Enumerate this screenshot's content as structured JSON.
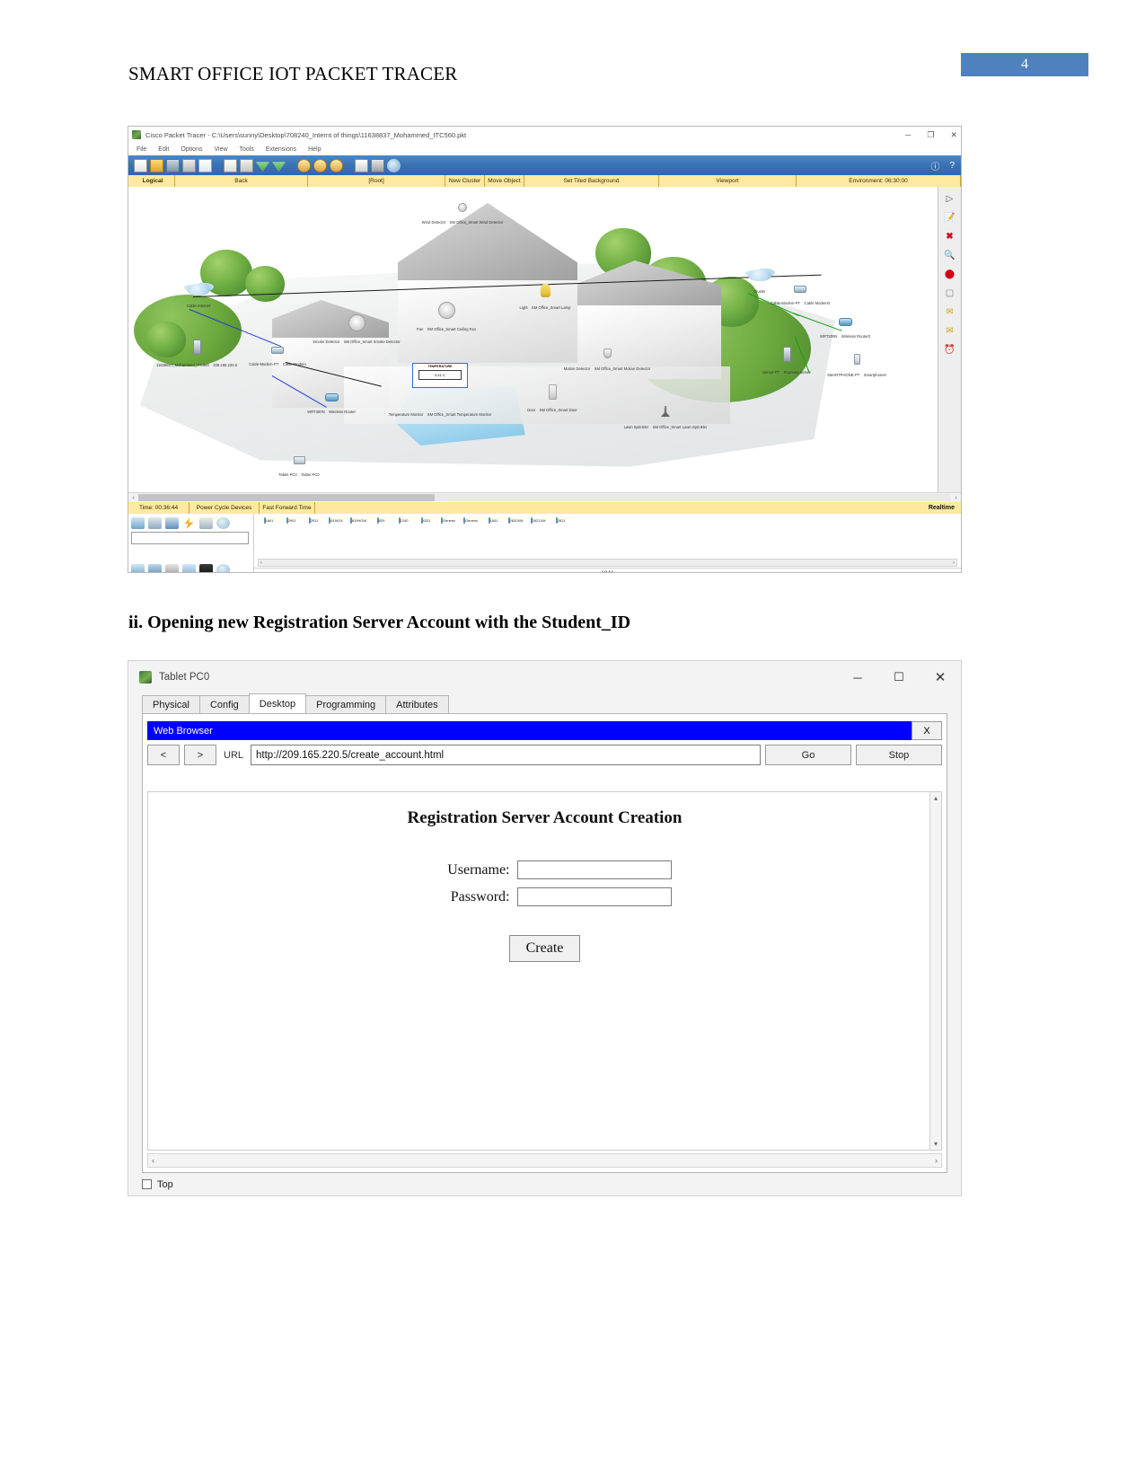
{
  "document": {
    "title": "SMART OFFICE IOT PACKET TRACER",
    "page_number": "4",
    "section_heading": "ii. Opening new Registration Server Account with the Student_ID",
    "accent_color": "#4f81bd"
  },
  "packet_tracer": {
    "window_title": "Cisco Packet Tracer - C:\\Users\\sunny\\Desktop\\708240_Internt of things\\11638837_Mohammed_ITC560.pkt",
    "window_controls": {
      "minimize": "─",
      "maximize": "❐",
      "close": "✕"
    },
    "menu": [
      "File",
      "Edit",
      "Options",
      "View",
      "Tools",
      "Extensions",
      "Help"
    ],
    "toolbar_icons": [
      "new-file-icon",
      "open-file-icon",
      "save-icon",
      "print-icon",
      "activity-wizard-icon",
      "copy-icon",
      "paste-icon",
      "undo-icon",
      "redo-icon",
      "zoom-in-icon",
      "zoom-reset-icon",
      "zoom-out-icon",
      "palette-icon",
      "custom-devices-icon",
      "network-info-icon"
    ],
    "toolbar_right": [
      "info-icon",
      "help-icon"
    ],
    "view_bar": {
      "mode": "Logical",
      "back": "Back",
      "root": "[Root]",
      "new_cluster": "New Cluster",
      "move_object": "Move Object",
      "set_tiled_background": "Set Tiled Background",
      "viewport": "Viewport",
      "environment": "Environment: 06:30:00"
    },
    "topology_nodes": [
      {
        "name": "Cable Internet",
        "label": "Cable Internet",
        "sublabel": ""
      },
      {
        "name": "cluster",
        "label": "Cluster",
        "sublabel": ""
      },
      {
        "name": "wind-detector",
        "label": "Wind Detector",
        "sublabel": "SM Office_Smart Wind Detector"
      },
      {
        "name": "smoke-detector",
        "label": "Smoke Detector",
        "sublabel": "SM Office_Smart Smoke Detector"
      },
      {
        "name": "ceiling-fan",
        "label": "Fan",
        "sublabel": "SM Office_Smart Ceiling Fan"
      },
      {
        "name": "smart-lamp",
        "label": "Light",
        "sublabel": "SM Office_Smart Lamp"
      },
      {
        "name": "motion-detector",
        "label": "Motion Detector",
        "sublabel": "SM Office_Smart Motion Detector"
      },
      {
        "name": "smart-door",
        "label": "Door",
        "sublabel": "SM Office_Smart Door"
      },
      {
        "name": "lawn-sprinkler",
        "label": "Lawn Sprinkler",
        "sublabel": "SM Office_Smart Lawn Sprinkler"
      },
      {
        "name": "temperature-monitor",
        "label": "Temperature Monitor",
        "sublabel": "SM Office_Smart Temperature Monitor"
      },
      {
        "name": "cable-modem-left",
        "label": "Cable-Modem-PT",
        "sublabel": "Cable Modem"
      },
      {
        "name": "cable-modem-right",
        "label": "Cable-Modem-PT",
        "sublabel": "Cable Modem0"
      },
      {
        "name": "wireless-router-wrt300n",
        "label": "WRT300N",
        "sublabel": "Wireless Router"
      },
      {
        "name": "wireless-router-wrt300n-right",
        "label": "WRT300N",
        "sublabel": "Wireless Router0"
      },
      {
        "name": "registration-server",
        "label": "Server-PT",
        "sublabel": "Roaming Server"
      },
      {
        "name": "smartphone",
        "label": "SMARTPHONE-PT",
        "sublabel": "Smartphone0"
      },
      {
        "name": "tablet-pc0",
        "label": "Tablet PC0",
        "sublabel": "Tablet PC0"
      },
      {
        "name": "student-server",
        "label": "11638837_Mohammed_ITC560",
        "sublabel": "209.165.220.5"
      }
    ],
    "temperature_monitor": {
      "caption": "TEMPERATURE",
      "reading": "0.41 C"
    },
    "status_bar": {
      "time": "Time: 00:36:44",
      "power_cycle": "Power Cycle Devices",
      "fast_forward": "Fast Forward Time",
      "realtime": "Realtime"
    },
    "palette": {
      "category_icons": [
        "network-devices-icon",
        "end-devices-icon",
        "components-icon",
        "connections-icon",
        "miscellaneous-icon",
        "multiuser-icon"
      ],
      "category_icons2": [
        "routers-icon",
        "switches-icon",
        "hubs-icon",
        "wireless-icon",
        "wan-emulation-icon",
        "cloud-icon"
      ],
      "search_value": "",
      "devices": [
        "1841",
        "2901",
        "2911",
        "819IOX",
        "819HGW",
        "829",
        "1240",
        "4321",
        "Generic",
        "Generic",
        "1841",
        "2620XM",
        "2621XM",
        "2811"
      ],
      "selected_device": "1841"
    }
  },
  "tablet": {
    "window_title": "Tablet PC0",
    "window_controls": {
      "minimize": "─",
      "maximize": "☐",
      "close": "✕"
    },
    "tabs": [
      {
        "label": "Physical",
        "active": false
      },
      {
        "label": "Config",
        "active": false
      },
      {
        "label": "Desktop",
        "active": true
      },
      {
        "label": "Programming",
        "active": false
      },
      {
        "label": "Attributes",
        "active": false
      }
    ],
    "browser": {
      "title": "Web Browser",
      "close_label": "X",
      "back_label": "<",
      "forward_label": ">",
      "url_label": "URL",
      "url_value": "http://209.165.220.5/create_account.html",
      "go_label": "Go",
      "stop_label": "Stop",
      "page": {
        "heading": "Registration Server Account Creation",
        "fields": [
          {
            "label": "Username:",
            "value": "",
            "name": "username-field"
          },
          {
            "label": "Password:",
            "value": "",
            "name": "password-field"
          }
        ],
        "submit_label": "Create"
      },
      "scroll_left": "‹",
      "scroll_right": "›",
      "scroll_up": "▴",
      "scroll_down": "▾"
    },
    "footer": {
      "top_checkbox_label": "Top",
      "checked": false
    }
  }
}
